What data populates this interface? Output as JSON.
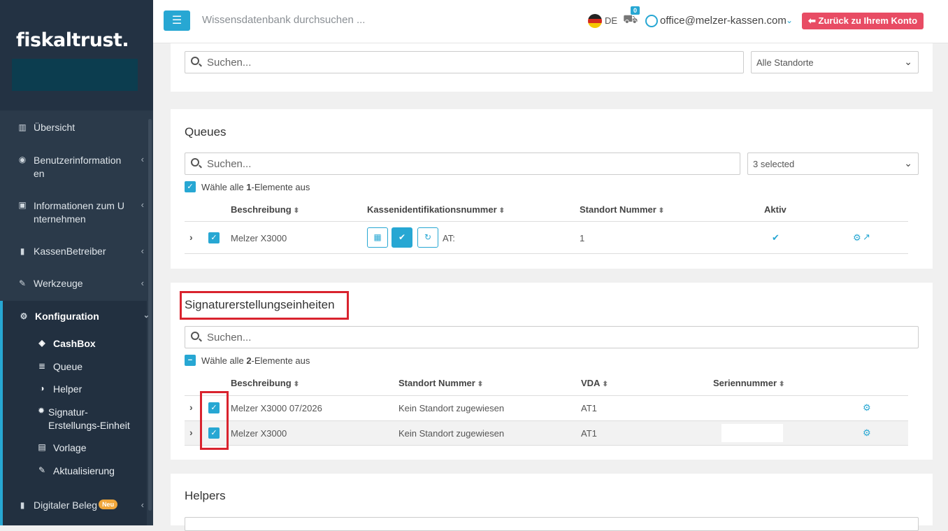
{
  "sidebar": {
    "logo": "fiskaltrust.",
    "items": [
      {
        "label": "Übersicht",
        "icon": "bar-chart-icon"
      },
      {
        "label": "Benutzerinformation",
        "label2": "en",
        "icon": "user-circle-icon"
      },
      {
        "label": "Informationen zum U",
        "label2": "nternehmen",
        "icon": "briefcase-icon"
      },
      {
        "label": "KassenBetreiber",
        "icon": "building-icon"
      },
      {
        "label": "Werkzeuge",
        "icon": "wrench-icon"
      },
      {
        "label": "Konfiguration",
        "icon": "cogs-icon"
      }
    ],
    "subitems": [
      {
        "label": "CashBox",
        "icon": "cube-icon"
      },
      {
        "label": "Queue",
        "icon": "database-icon"
      },
      {
        "label": "Helper",
        "icon": "half-circle-icon"
      },
      {
        "label": "Signatur-",
        "label2": "Erstellungs-Einheit",
        "icon": "gear-icon"
      },
      {
        "label": "Vorlage",
        "icon": "file-icon"
      },
      {
        "label": "Aktualisierung",
        "icon": "wrench-icon"
      }
    ],
    "digital": {
      "label": "Digitaler Beleg",
      "badge": "Neu"
    }
  },
  "topbar": {
    "search_placeholder": "Wissensdatenbank durchsuchen ...",
    "lang": "DE",
    "cart_count": "0",
    "email": "office@melzer-kassen.com",
    "back_button": "Zurück zu Ihrem Konto"
  },
  "top_panel": {
    "search_placeholder": "Suchen...",
    "select_value": "Alle Standorte"
  },
  "queues": {
    "title": "Queues",
    "search_placeholder": "Suchen...",
    "select_value": "3 selected",
    "select_all_pre": "Wähle alle ",
    "select_all_count": "1",
    "select_all_post": "-Elemente aus",
    "columns": [
      "Beschreibung",
      "Kassenidentifikationsnummer",
      "Standort Nummer",
      "Aktiv"
    ],
    "rows": [
      {
        "beschreibung": "Melzer X3000",
        "kassen_id": "AT:",
        "standort": "1",
        "aktiv": true
      }
    ]
  },
  "sse": {
    "title": "Signaturerstellungseinheiten",
    "search_placeholder": "Suchen...",
    "select_all_pre": "Wähle alle ",
    "select_all_count": "2",
    "select_all_post": "-Elemente aus",
    "columns": [
      "Beschreibung",
      "Standort Nummer",
      "VDA",
      "Seriennummer"
    ],
    "rows": [
      {
        "beschreibung": "Melzer X3000 07/2026",
        "standort": "Kein Standort zugewiesen",
        "vda": "AT1",
        "serial": ""
      },
      {
        "beschreibung": "Melzer X3000",
        "standort": "Kein Standort zugewiesen",
        "vda": "AT1",
        "serial": ""
      }
    ]
  },
  "helpers": {
    "title": "Helpers"
  },
  "colors": {
    "accent": "#27a7d3",
    "sidebar": "#2b3a4a",
    "danger": "#e84c64",
    "highlight": "#d9232e"
  }
}
